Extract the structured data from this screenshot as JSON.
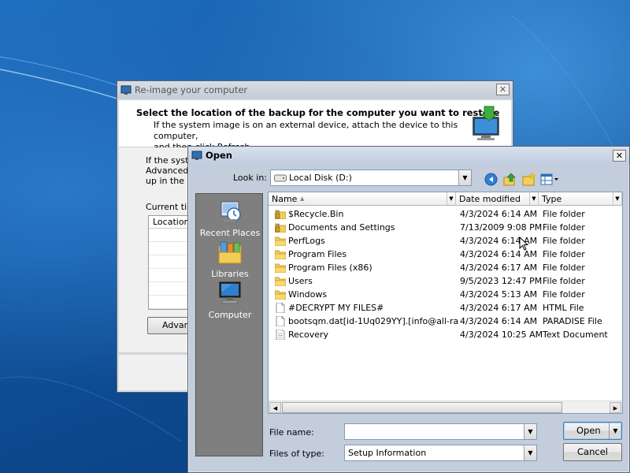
{
  "reimage_window": {
    "title": "Re-image your computer",
    "close": "✕",
    "heading": "Select the location of the backup for the computer you want to restore",
    "subtext_line1": "If the system image is on an external device, attach the device to this computer,",
    "subtext_line2": "and then click Refresh.",
    "body_line1": "If the syste",
    "body_line2": "Advanced t",
    "body_line3": "up in the lis",
    "current_label": "Current tim",
    "table_header": "Location",
    "advanced_button": "Advanc"
  },
  "open_dialog": {
    "title": "Open",
    "close": "✕",
    "look_in_label": "Look in:",
    "look_in_value": "Local Disk (D:)",
    "toolbar_icons": [
      "back-icon",
      "up-folder-icon",
      "new-folder-icon",
      "view-menu-icon"
    ],
    "places": [
      {
        "label": "Recent Places",
        "icon": "recent-places-icon"
      },
      {
        "label": "Libraries",
        "icon": "libraries-icon"
      },
      {
        "label": "Computer",
        "icon": "computer-icon"
      }
    ],
    "columns": {
      "name": "Name",
      "date": "Date modified",
      "type": "Type"
    },
    "files": [
      {
        "name": "$Recycle.Bin",
        "date": "4/3/2024 6:14 AM",
        "type": "File folder",
        "icon": "locked-folder-icon"
      },
      {
        "name": "Documents and Settings",
        "date": "7/13/2009 9:08 PM",
        "type": "File folder",
        "icon": "locked-folder-icon"
      },
      {
        "name": "PerfLogs",
        "date": "4/3/2024 6:14 AM",
        "type": "File folder",
        "icon": "folder-icon"
      },
      {
        "name": "Program Files",
        "date": "4/3/2024 6:14 AM",
        "type": "File folder",
        "icon": "folder-icon"
      },
      {
        "name": "Program Files (x86)",
        "date": "4/3/2024 6:17 AM",
        "type": "File folder",
        "icon": "folder-icon"
      },
      {
        "name": "Users",
        "date": "9/5/2023 12:47 PM",
        "type": "File folder",
        "icon": "folder-icon"
      },
      {
        "name": "Windows",
        "date": "4/3/2024 5:13 AM",
        "type": "File folder",
        "icon": "folder-icon"
      },
      {
        "name": "#DECRYPT MY FILES#",
        "date": "4/3/2024 6:17 AM",
        "type": "HTML File",
        "icon": "file-icon"
      },
      {
        "name": "bootsqm.dat[id-1Uq029YY].[info@all-ran...",
        "date": "4/3/2024 6:14 AM",
        "type": "PARADISE File",
        "icon": "file-icon"
      },
      {
        "name": "Recovery",
        "date": "4/3/2024 10:25 AM",
        "type": "Text Document",
        "icon": "text-file-icon"
      }
    ],
    "file_name_label": "File name:",
    "file_name_value": "",
    "files_of_type_label": "Files of type:",
    "files_of_type_value": "Setup Information",
    "open_button": "Open",
    "cancel_button": "Cancel"
  }
}
